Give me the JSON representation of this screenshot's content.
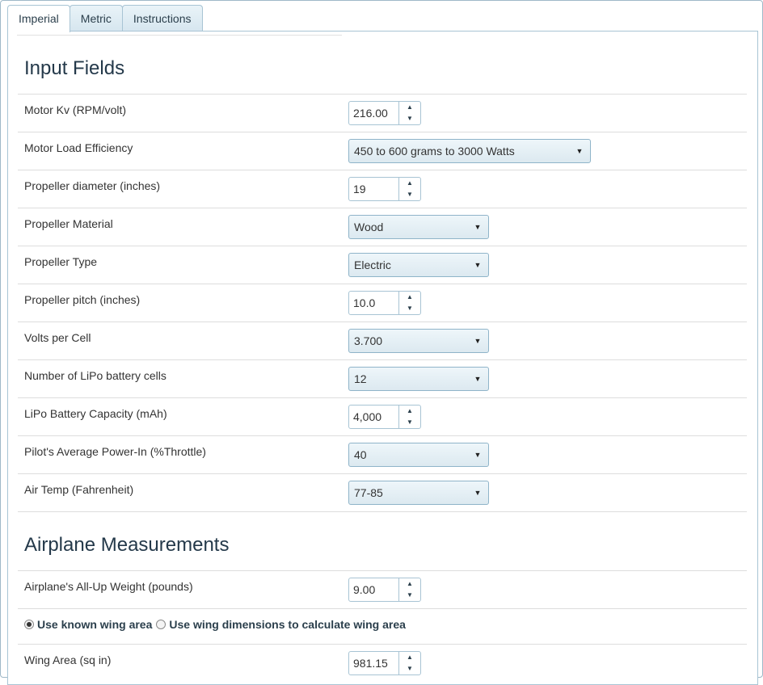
{
  "tabs": [
    {
      "label": "Imperial",
      "active": true
    },
    {
      "label": "Metric",
      "active": false
    },
    {
      "label": "Instructions",
      "active": false
    }
  ],
  "input_fields": {
    "title": "Input Fields",
    "motor_kv": {
      "label": "Motor Kv (RPM/volt)",
      "value": "216.00"
    },
    "motor_load_efficiency": {
      "label": "Motor Load Efficiency",
      "value": "450 to 600 grams to 3000 Watts"
    },
    "prop_diameter": {
      "label": "Propeller diameter (inches)",
      "value": "19"
    },
    "prop_material": {
      "label": "Propeller Material",
      "value": "Wood"
    },
    "prop_type": {
      "label": "Propeller Type",
      "value": "Electric"
    },
    "prop_pitch": {
      "label": "Propeller pitch (inches)",
      "value": "10.0"
    },
    "volts_per_cell": {
      "label": "Volts per Cell",
      "value": "3.700"
    },
    "lipo_cells": {
      "label": "Number of LiPo battery cells",
      "value": "12"
    },
    "lipo_capacity": {
      "label": "LiPo Battery Capacity (mAh)",
      "value": "4,000"
    },
    "avg_power_in": {
      "label": "Pilot's Average Power-In (%Throttle)",
      "value": "40"
    },
    "air_temp": {
      "label": "Air Temp (Fahrenheit)",
      "value": "77-85"
    }
  },
  "airplane": {
    "title": "Airplane Measurements",
    "weight": {
      "label": "Airplane's All-Up Weight (pounds)",
      "value": "9.00"
    },
    "radio_known": {
      "label": "Use known wing area",
      "checked": true
    },
    "radio_dimensions": {
      "label": "Use wing dimensions to calculate wing area",
      "checked": false
    },
    "wing_area": {
      "label": "Wing Area (sq in)",
      "value": "981.15"
    }
  },
  "icons": {
    "spinner_up": "▲",
    "spinner_down": "▼",
    "caret": "▼"
  }
}
